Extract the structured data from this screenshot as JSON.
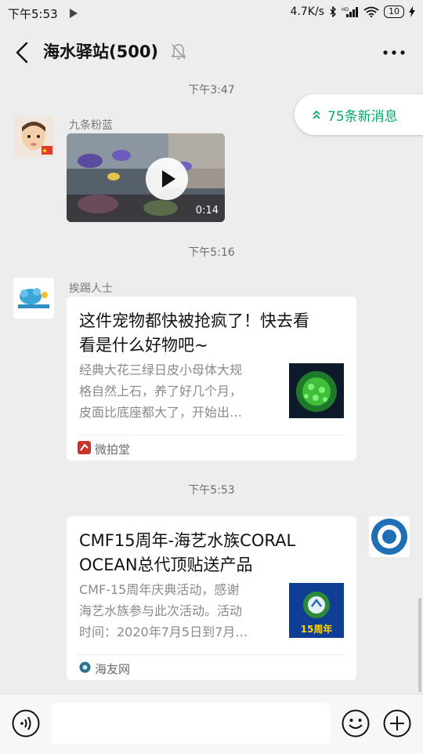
{
  "status_bar": {
    "time": "下午5:53",
    "network_speed": "4.7K/s",
    "battery": "10"
  },
  "header": {
    "title": "海水驿站(500)"
  },
  "new_messages": {
    "label": "75条新消息"
  },
  "messages": [
    {
      "type": "timestamp",
      "text": "下午3:47"
    },
    {
      "type": "video",
      "sender": "九条粉蓝",
      "duration": "0:14"
    },
    {
      "type": "timestamp",
      "text": "下午5:16"
    },
    {
      "type": "link",
      "sender": "挨踢人士",
      "title_lines": [
        "这件宠物都快被抢疯了！快去看",
        "看是什么好物吧~"
      ],
      "desc_lines": [
        "经典大花三绿日皮小母体大规",
        "格自然上石，养了好几个月，",
        "皮面比底座都大了，开始出…"
      ],
      "source": "微拍堂"
    },
    {
      "type": "timestamp",
      "text": "下午5:53"
    },
    {
      "type": "link",
      "sender": "",
      "title_lines": [
        "CMF15周年-海艺水族CORAL",
        "OCEAN总代顶贴送产品"
      ],
      "desc_lines": [
        "CMF-15周年庆典活动，感谢",
        "海艺水族参与此次活动。活动",
        "时间：2020年7月5日到7月…"
      ],
      "source": "海友网",
      "thumb_badge": "15周年"
    }
  ],
  "colors": {
    "accent_green": "#07a86a",
    "background": "#ededed"
  }
}
